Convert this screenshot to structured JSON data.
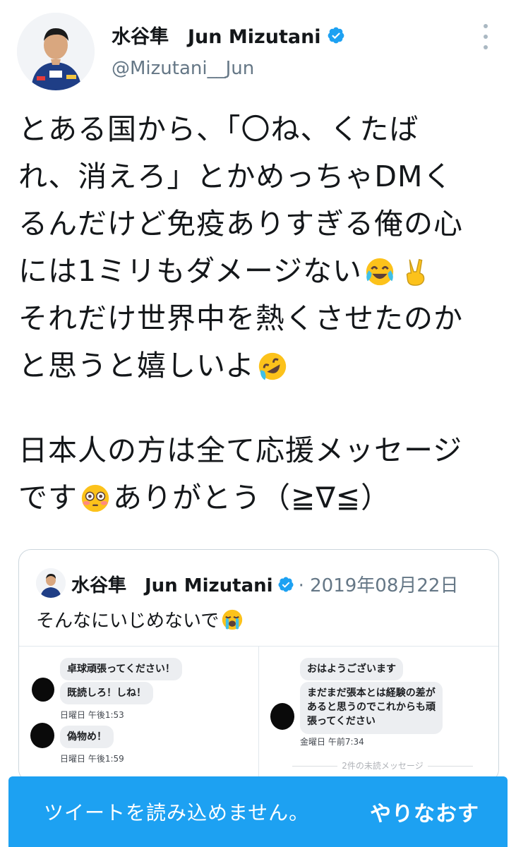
{
  "tweet": {
    "author": {
      "display_name": "水谷隼　Jun Mizutani",
      "handle": "@Mizutani__Jun",
      "verified": true
    },
    "text_lines": [
      "とある国から、「〇ね、くたば",
      "れ、消えろ」とかめっちゃDMく",
      "るんだけど免疫ありすぎる俺の心",
      "には1ミリもダメージない",
      "それだけ世界中を熱くさせたのか",
      "と思うと嬉しいよ",
      "",
      "日本人の方は全て応援メッセージ",
      "です",
      "ありがとう（≧∇≦）"
    ],
    "emojis": [
      "face-with-tears-of-joy",
      "victory-hand",
      "rolling-on-floor-laughing",
      "flushed-face"
    ]
  },
  "quote": {
    "display_name": "水谷隼　Jun Mizutani",
    "verified": true,
    "date": "· 2019年08月22日",
    "text": "そんなにいじめないで",
    "emoji": "loudly-crying-face",
    "media": {
      "left": {
        "bubbles": [
          "卓球頑張ってください！",
          "既読しろ！しね！",
          "偽物め！"
        ],
        "timestamps": [
          "日曜日 午後1:53",
          "日曜日 午後1:59"
        ]
      },
      "right": {
        "bubbles": [
          "おはようございます",
          "まだまだ張本とは経験の差が",
          "あると思うのでこれからも頑",
          "張ってください"
        ],
        "timestamps": [
          "金曜日 午前7:34"
        ],
        "unread": "2件の未読メッセージ"
      }
    }
  },
  "snackbar": {
    "message": "ツイートを読み込めません。",
    "action": "やりなおす"
  },
  "colors": {
    "accent": "#1da1f2",
    "secondary_text": "#657786",
    "border": "#ccd6dd"
  }
}
